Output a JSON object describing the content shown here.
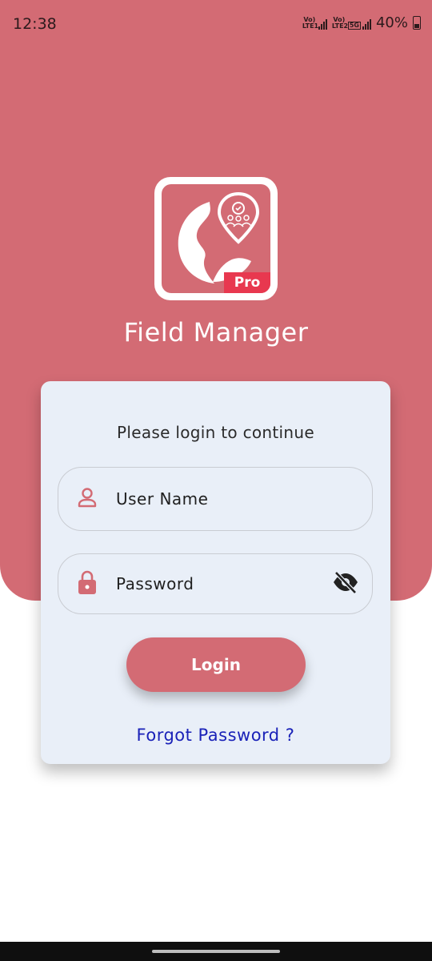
{
  "status_bar": {
    "time": "12:38",
    "sim1_label": "Vo) LTE1",
    "sim2_label": "Vo) LTE2",
    "network": "5G",
    "battery": "40%"
  },
  "app": {
    "title": "Field Manager",
    "badge": "Pro"
  },
  "login": {
    "prompt": "Please login to continue",
    "username_placeholder": "User Name",
    "password_placeholder": "Password",
    "login_label": "Login",
    "forgot_label": "Forgot Password ?"
  },
  "colors": {
    "brand": "#d36b74",
    "card": "#e9eff8",
    "link": "#1a22b8"
  },
  "icons": {
    "user": "user-icon",
    "lock": "lock-icon",
    "visibility_off": "eye-off-icon"
  }
}
